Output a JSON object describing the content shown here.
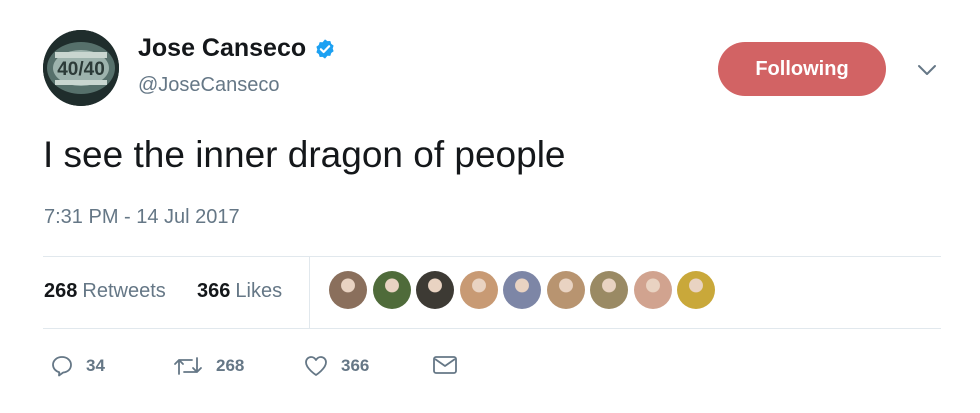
{
  "user": {
    "display_name": "Jose Canseco",
    "handle": "@JoseCanseco",
    "verified": true,
    "avatar_text": "40/40"
  },
  "follow_button": {
    "label": "Following",
    "color": "#d26364"
  },
  "tweet": {
    "text": "I see the inner dragon of people",
    "timestamp": "7:31 PM - 14 Jul 2017"
  },
  "stats": {
    "retweets_count": "268",
    "retweets_label": "Retweets",
    "likes_count": "366",
    "likes_label": "Likes"
  },
  "likers": [
    {
      "color": "#8a6f5c"
    },
    {
      "color": "#4f6b3a"
    },
    {
      "color": "#3d3a34"
    },
    {
      "color": "#c89a74"
    },
    {
      "color": "#7d86a6"
    },
    {
      "color": "#b89470"
    },
    {
      "color": "#9a8a64"
    },
    {
      "color": "#d1a38f"
    },
    {
      "color": "#c9a83a"
    }
  ],
  "actions": {
    "reply_count": "34",
    "retweet_count": "268",
    "like_count": "366"
  },
  "colors": {
    "text": "#14171a",
    "secondary": "#657786",
    "verified": "#1da1f2",
    "divider": "#e1e8ed"
  }
}
